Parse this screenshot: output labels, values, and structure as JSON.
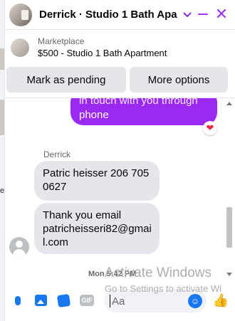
{
  "header": {
    "title": "Derrick · Studio 1 Bath Apa…",
    "chevron_icon": "chevron-down-icon",
    "minimize_icon": "minimize-icon",
    "close_glyph": "✕"
  },
  "listing": {
    "kicker": "Marketplace",
    "name": "$500 - Studio 1 Bath Apartment"
  },
  "actions": {
    "pending_label": "Mark as pending",
    "more_label": "More options"
  },
  "messages": {
    "outgoing": {
      "line1": "in touch with you through",
      "line2": "phone",
      "reaction": "❤"
    },
    "sender_name": "Derrick",
    "incoming": [
      {
        "text": "Patric heisser 206 705 0627"
      },
      {
        "text": "Thank you email patricheisseri82@gmail.com"
      }
    ],
    "timestamp": "Mon 5:42 PM"
  },
  "watermark": {
    "line1": "Activate Windows",
    "line2": "Go to Settings to activate Wi"
  },
  "composer": {
    "placeholder": "Aa",
    "gif_label": "GIF",
    "emoji_glyph": "☺",
    "like_glyph": "👍"
  },
  "page_fragments": [
    "e"
  ]
}
